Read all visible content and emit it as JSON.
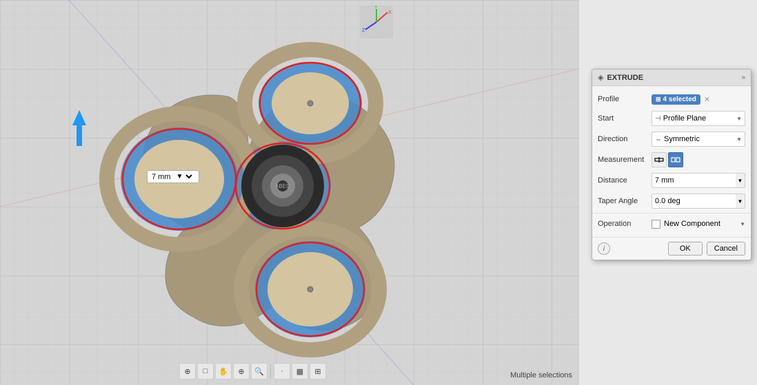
{
  "viewport": {
    "background": "#d4d4d4"
  },
  "dimension_label": {
    "value": "7 mm"
  },
  "extrude_dialog": {
    "title": "EXTRUDE",
    "rows": {
      "profile_label": "Profile",
      "profile_value": "4 selected",
      "start_label": "Start",
      "start_value": "Profile Plane",
      "direction_label": "Direction",
      "direction_value": "Symmetric",
      "measurement_label": "Measurement",
      "distance_label": "Distance",
      "distance_value": "7 mm",
      "taper_angle_label": "Taper Angle",
      "taper_angle_value": "0.0 deg",
      "operation_label": "Operation",
      "operation_value": "New Component"
    },
    "footer": {
      "ok_label": "OK",
      "cancel_label": "Cancel",
      "info_symbol": "i"
    }
  },
  "bottom_toolbar": {
    "buttons": [
      "⊕",
      "□",
      "✋",
      "⊕",
      "🔍",
      "·",
      "▦",
      "⊞"
    ]
  },
  "status_bar": {
    "text": "Multiple selections"
  }
}
